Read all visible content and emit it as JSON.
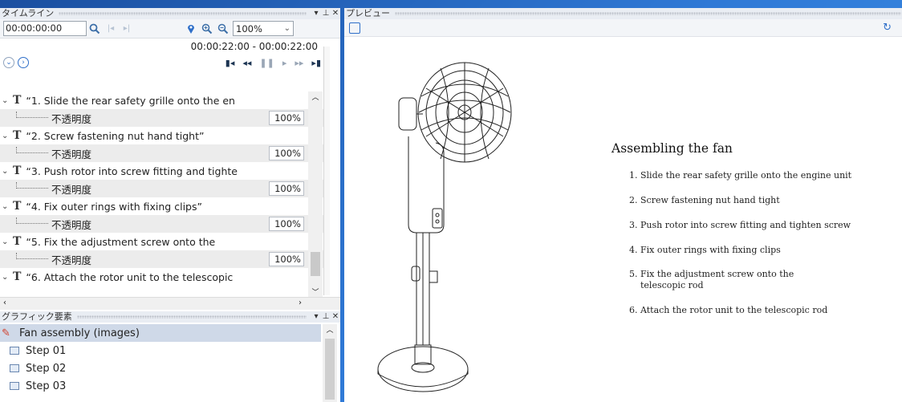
{
  "timeline": {
    "title": "タイムライン",
    "pin_icon": "pin",
    "close_icon": "close",
    "current_time": "00:00:00:00",
    "zoom_level": "100%",
    "range": "00:00:22:00  -  00:00:22:00",
    "tracks": [
      {
        "label": "“1. Slide the rear safety grille onto the en",
        "prop": "不透明度",
        "value": "100%"
      },
      {
        "label": "“2. Screw fastening nut hand tight”",
        "prop": "不透明度",
        "value": "100%"
      },
      {
        "label": "“3. Push rotor into screw fitting and tighte",
        "prop": "不透明度",
        "value": "100%"
      },
      {
        "label": "“4. Fix outer rings with fixing clips”",
        "prop": "不透明度",
        "value": "100%"
      },
      {
        "label": "“5. Fix the adjustment screw onto the",
        "prop": "不透明度",
        "value": "100%"
      },
      {
        "label": "“6. Attach the rotor unit to the telescopic",
        "prop": null,
        "value": null
      }
    ]
  },
  "graphics": {
    "title": "グラフィック要素",
    "root": "Fan assembly (images)",
    "items": [
      "Step 01",
      "Step 02",
      "Step 03"
    ]
  },
  "preview": {
    "title": "プレビュー",
    "doc_title": "Assembling the fan",
    "steps": [
      "1. Slide the rear safety grille onto the engine unit",
      "2. Screw fastening nut hand tight",
      "3. Push rotor into screw fitting and tighten screw",
      "4. Fix outer rings with fixing clips",
      "5. Fix the adjustment screw onto the",
      "telescopic rod",
      "6. Attach the rotor unit to the telescopic rod"
    ]
  }
}
